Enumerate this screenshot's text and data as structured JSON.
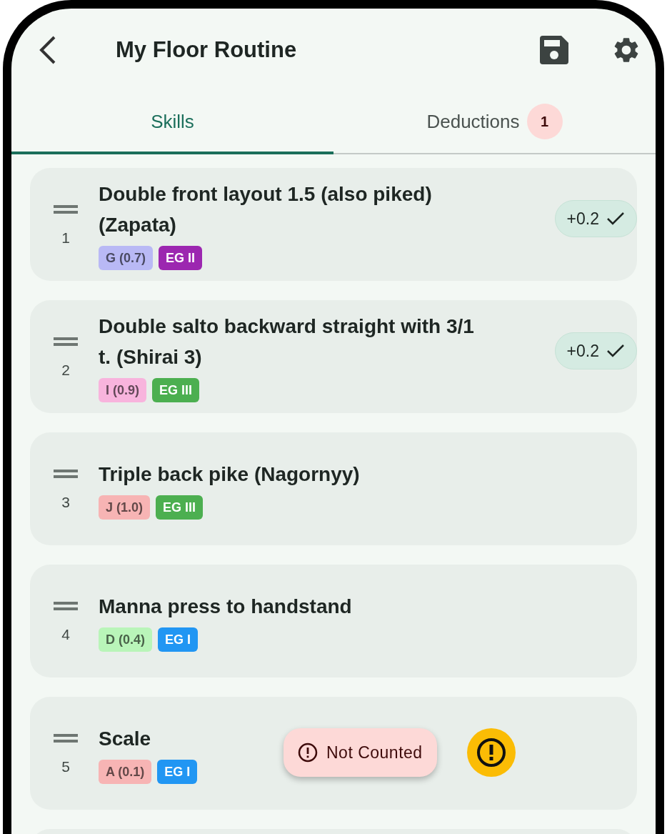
{
  "header": {
    "title": "My Floor Routine"
  },
  "tabs": [
    {
      "label": "Skills",
      "selected": true
    },
    {
      "label": "Deductions",
      "selected": false,
      "badge": "1"
    }
  ],
  "skills": [
    {
      "kind": "skill",
      "number": "1",
      "name": "Double front layout 1.5 (also piked) (Zapata)",
      "value_tag": {
        "label": "G (0.7)",
        "color": "#b9b9f5"
      },
      "group_tag": {
        "label": "EG II",
        "color": "#9c27b0"
      },
      "bonus": "+0.2"
    },
    {
      "kind": "skill",
      "number": "2",
      "name": "Double salto backward straight with 3/1 t. (Shirai 3)",
      "value_tag": {
        "label": "I (0.9)",
        "color": "#f8b4dd"
      },
      "group_tag": {
        "label": "EG III",
        "color": "#4caf50"
      },
      "bonus": "+0.2"
    },
    {
      "kind": "skill",
      "number": "3",
      "name": "Triple back pike (Nagornyy)",
      "value_tag": {
        "label": "J (1.0)",
        "color": "#f7b4b4"
      },
      "group_tag": {
        "label": "EG III",
        "color": "#4caf50"
      }
    },
    {
      "kind": "skill",
      "number": "4",
      "name": "Manna press to handstand",
      "value_tag": {
        "label": "D (0.4)",
        "color": "#b9f5b9"
      },
      "group_tag": {
        "label": "EG I",
        "color": "#2196f3"
      }
    },
    {
      "kind": "skill",
      "number": "5",
      "name": "Scale",
      "value_tag": {
        "label": "A (0.1)",
        "color": "#f7b4b4"
      },
      "group_tag": {
        "label": "EG I",
        "color": "#2196f3"
      },
      "warning": "Not Counted"
    },
    {
      "kind": "cut"
    }
  ]
}
